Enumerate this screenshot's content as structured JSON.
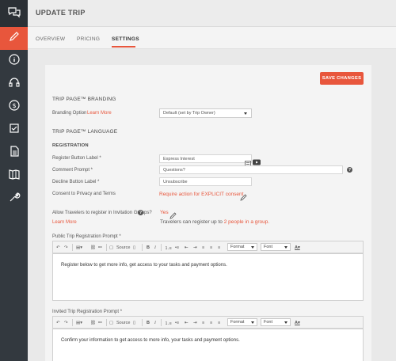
{
  "header": {
    "title": "UPDATE TRIP"
  },
  "tabs": [
    {
      "label": "OVERVIEW",
      "active": false
    },
    {
      "label": "PRICING",
      "active": false
    },
    {
      "label": "SETTINGS",
      "active": true
    }
  ],
  "sidebar": {
    "items": [
      {
        "icon": "chat-bubbles-icon",
        "active": false
      },
      {
        "icon": "pencil-icon",
        "active": true
      },
      {
        "icon": "info-icon",
        "active": false
      },
      {
        "icon": "support-headset-icon",
        "active": false
      },
      {
        "icon": "dollar-icon",
        "active": false
      },
      {
        "icon": "checklist-icon",
        "active": false
      },
      {
        "icon": "document-icon",
        "active": false
      },
      {
        "icon": "map-icon",
        "active": false
      },
      {
        "icon": "wrench-icon",
        "active": false
      }
    ]
  },
  "actions": {
    "save_label": "SAVE CHANGES"
  },
  "branding": {
    "section_title": "TRIP PAGE™ BRANDING",
    "option_label": "Branding Option",
    "learn_more": "Learn More",
    "selected": "Default (set by Trip Owner)"
  },
  "language": {
    "section_title": "TRIP PAGE™ LANGUAGE",
    "registration_title": "REGISTRATION",
    "register_label": "Register Button Label *",
    "register_value": "Express Interest",
    "comment_label": "Comment Prompt *",
    "comment_value": "Questions?",
    "decline_label": "Decline Button Label *",
    "decline_value": "Unsubscribe",
    "consent_label": "Consent to Privacy and Terms",
    "consent_action": "Require action for EXPLICIT consent",
    "allow_label": "Allow Travelers to register in Invitation Groups?",
    "allow_learn_more": "Learn More",
    "allow_value": "Yes",
    "allow_desc_prefix": "Travelers can register up to",
    "allow_desc_link": "2 people in a group."
  },
  "editors": {
    "public_label": "Public Trip Registration Prompt *",
    "public_text": "Register below to get more info, get access to your tasks and payment options.",
    "invited_label": "Invited Trip Registration Prompt *",
    "invited_text": "Confirm your information to get access to more info, your tasks and payment options.",
    "toolbar": {
      "source": "Source",
      "format": "Format",
      "font": "Font"
    }
  },
  "colors": {
    "accent": "#e8563c",
    "sidebar": "#33393f"
  }
}
